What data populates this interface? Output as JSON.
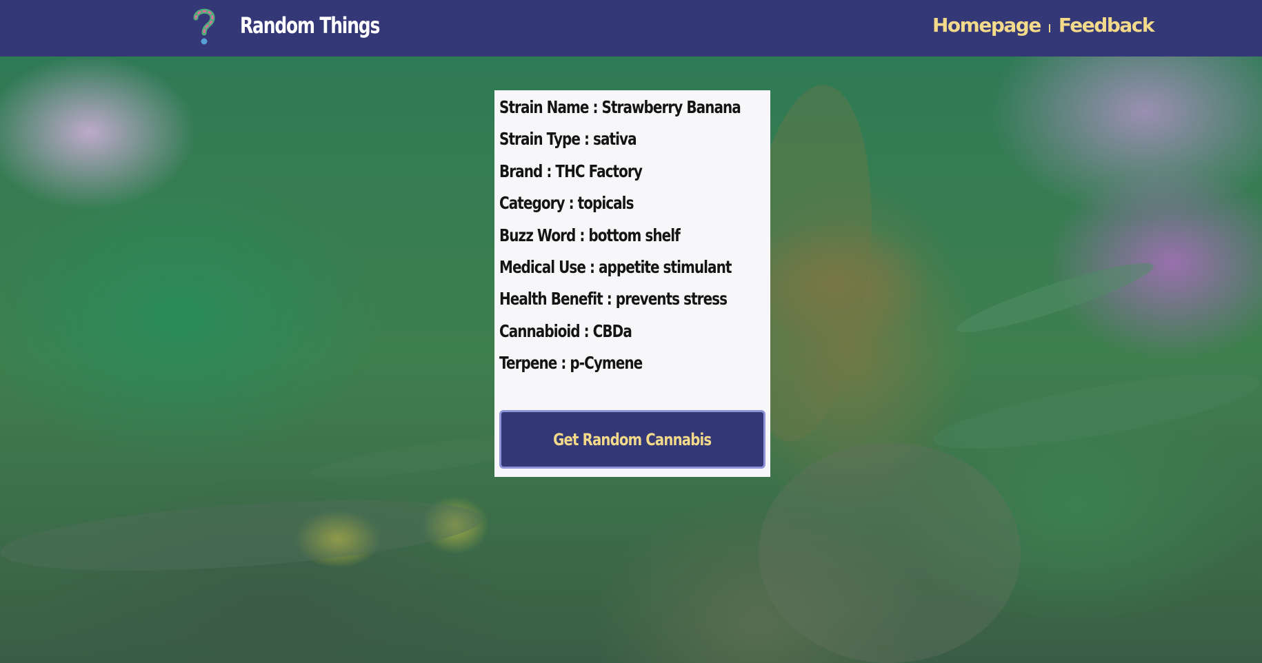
{
  "header": {
    "brand_icon": "question-mark-icon",
    "brand_title": "Random Things",
    "nav": [
      {
        "label": "Homepage"
      },
      {
        "label": "Feedback"
      }
    ]
  },
  "card": {
    "fields": [
      {
        "label": "Strain Name",
        "value": "Strawberry Banana",
        "text": "Strain Name : Strawberry Banana"
      },
      {
        "label": "Strain Type",
        "value": "sativa",
        "text": "Strain Type : sativa"
      },
      {
        "label": "Brand",
        "value": "THC Factory",
        "text": "Brand : THC Factory"
      },
      {
        "label": "Category",
        "value": "topicals",
        "text": "Category : topicals"
      },
      {
        "label": "Buzz Word",
        "value": "bottom shelf",
        "text": "Buzz Word : bottom shelf"
      },
      {
        "label": "Medical Use",
        "value": "appetite stimulant",
        "text": "Medical Use : appetite stimulant"
      },
      {
        "label": "Health Benefit",
        "value": "prevents stress",
        "text": "Health Benefit : prevents stress"
      },
      {
        "label": "Cannabioid",
        "value": "CBDa",
        "text": "Cannabioid : CBDa"
      },
      {
        "label": "Terpene",
        "value": "p-Cymene",
        "text": "Terpene : p-Cymene"
      }
    ],
    "button_label": "Get Random Cannabis"
  },
  "colors": {
    "navbar": "#353877",
    "accent_text": "#f3d98a",
    "card_background": "#f7f7f9",
    "button_border": "#8f93d8"
  }
}
